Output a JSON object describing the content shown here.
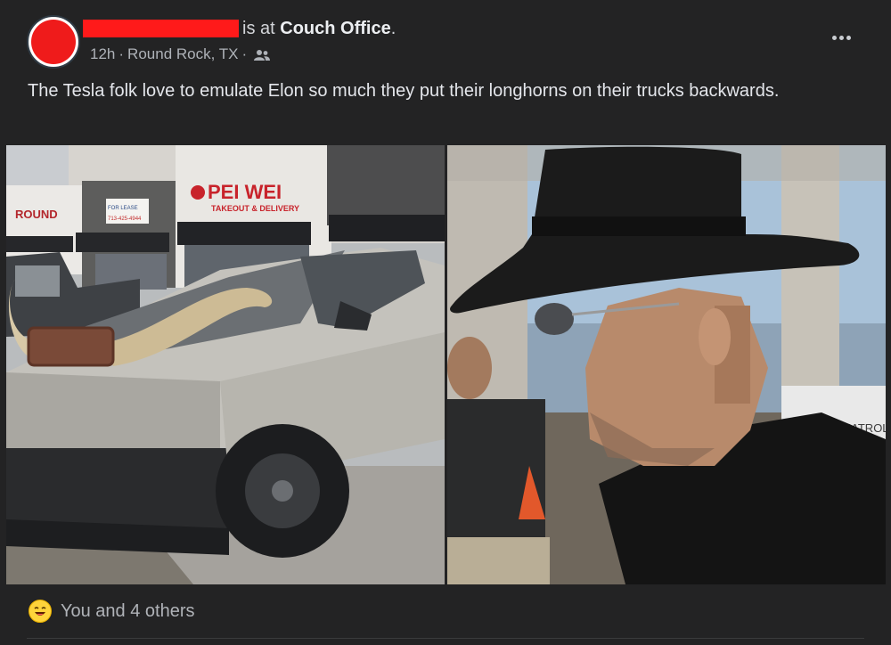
{
  "post": {
    "checkin_prefix": "is at",
    "place": "Couch Office",
    "place_suffix": ".",
    "time": "12h",
    "separator": "·",
    "location": "Round Rock, TX",
    "audience_icon": "friends-icon",
    "more_icon": "more-dots-icon",
    "text": "The Tesla folk love to emulate Elon so much they put their longhorns on their trucks backwards.",
    "colors": {
      "redaction": "#ff1a1a",
      "background": "#232324"
    }
  },
  "photos": {
    "left_signs": {
      "store": "PEI WEI",
      "store_sub": "TAKEOUT & DELIVERY",
      "round": "ROUND",
      "lease": "FOR LEASE",
      "phone": "713-425-4944"
    },
    "right_signs": {
      "truck": "RDER PATROL"
    }
  },
  "reactions": {
    "icon": "laughing-emoji-icon",
    "label": "You and 4 others"
  }
}
